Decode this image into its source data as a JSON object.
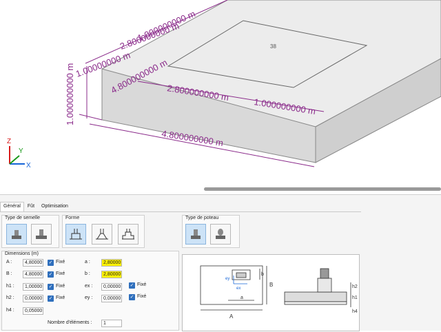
{
  "viewport": {
    "slab_label": "38",
    "dims": {
      "top_a": "1.000000000 m",
      "top_b": "2.800000000 m",
      "left_height": "1.000000000 m",
      "left_b": "1.00000000 m",
      "mid_b": "4.800000000 m",
      "mid_a": "2.800000000 m",
      "right_a": "1.000000000 m",
      "bottom_a": "4.800000000 m",
      "vertical": "1.000000000 m"
    },
    "axes": {
      "x": "X",
      "y": "Y",
      "z": "Z"
    },
    "colors": {
      "dim": "#8a2a8a",
      "slab_top": "#ececec",
      "slab_front": "#d6d6d6",
      "slab_side": "#c8c8c8"
    }
  },
  "tabs": [
    {
      "label": "Général",
      "active": true
    },
    {
      "label": "Fût",
      "active": false
    },
    {
      "label": "Optimisation",
      "active": false
    }
  ],
  "groups": {
    "type_semelle": "Type de semelle",
    "forme": "Forme",
    "type_poteau": "Type de poteau",
    "dimensions": "Dimensions (m)"
  },
  "fields": {
    "A": {
      "label": "A :",
      "value": "4,80000",
      "fixed_label": "Fixé"
    },
    "B": {
      "label": "B :",
      "value": "4,80000",
      "fixed_label": "Fixé"
    },
    "h1": {
      "label": "h1 :",
      "value": "1,00000",
      "fixed_label": "Fixé"
    },
    "h2": {
      "label": "h2 :",
      "value": "0,00000",
      "fixed_label": "Fixé"
    },
    "h4": {
      "label": "h4 :",
      "value": "0,05000"
    },
    "a": {
      "label": "a :",
      "value": "2,80000"
    },
    "b": {
      "label": "b :",
      "value": "2,80000"
    },
    "ex": {
      "label": "ex :",
      "value": "0,00000",
      "fixed_label": "Fixé"
    },
    "ey": {
      "label": "ey :",
      "value": "0,00000",
      "fixed_label": "Fixé"
    },
    "nb": {
      "label": "Nombre d'éléments :",
      "value": "1"
    }
  },
  "preview": {
    "labels": {
      "A": "A",
      "B": "B",
      "a": "a",
      "b": "b",
      "ey": "ey",
      "ex": "ex",
      "h1": "h1",
      "h2": "h2",
      "h4": "h4"
    }
  }
}
